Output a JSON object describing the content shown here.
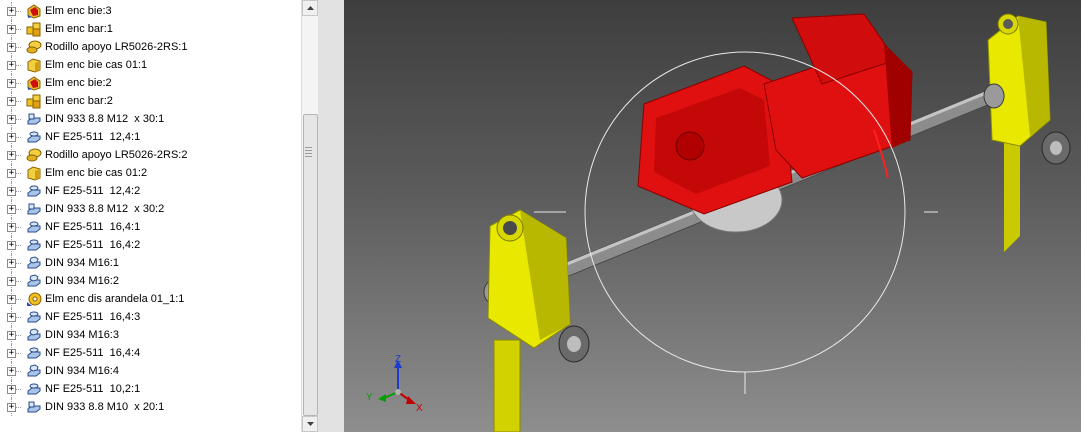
{
  "browser": {
    "items": [
      {
        "label": "Elm enc bie:3",
        "icon": "part-red-icon"
      },
      {
        "label": "Elm enc bar:1",
        "icon": "assembly-icon"
      },
      {
        "label": "Rodillo apoyo LR5026-2RS:1",
        "icon": "roller-icon"
      },
      {
        "label": "Elm enc bie cas 01:1",
        "icon": "part-yellow-icon"
      },
      {
        "label": "Elm enc bie:2",
        "icon": "part-red-icon"
      },
      {
        "label": "Elm enc bar:2",
        "icon": "assembly-icon"
      },
      {
        "label": "DIN 933 8.8 M12  x 30:1",
        "icon": "bolt-icon"
      },
      {
        "label": "NF E25-511  12,4:1",
        "icon": "washer-icon"
      },
      {
        "label": "Rodillo apoyo LR5026-2RS:2",
        "icon": "roller-icon"
      },
      {
        "label": "Elm enc bie cas 01:2",
        "icon": "part-yellow-icon"
      },
      {
        "label": "NF E25-511  12,4:2",
        "icon": "washer-icon"
      },
      {
        "label": "DIN 933 8.8 M12  x 30:2",
        "icon": "bolt-icon"
      },
      {
        "label": "NF E25-511  16,4:1",
        "icon": "washer-icon"
      },
      {
        "label": "NF E25-511  16,4:2",
        "icon": "washer-icon"
      },
      {
        "label": "DIN 934 M16:1",
        "icon": "nut-icon"
      },
      {
        "label": "DIN 934 M16:2",
        "icon": "nut-icon"
      },
      {
        "label": "Elm enc dis arandela 01_1:1",
        "icon": "part-assembly-icon"
      },
      {
        "label": "NF E25-511  16,4:3",
        "icon": "washer-icon"
      },
      {
        "label": "DIN 934 M16:3",
        "icon": "nut-icon"
      },
      {
        "label": "NF E25-511  16,4:4",
        "icon": "washer-icon"
      },
      {
        "label": "DIN 934 M16:4",
        "icon": "nut-icon"
      },
      {
        "label": "NF E25-511  10,2:1",
        "icon": "washer-icon"
      },
      {
        "label": "DIN 933 8.8 M10  x 20:1",
        "icon": "bolt-icon"
      }
    ]
  },
  "viewport": {
    "triad": {
      "x_label": "X",
      "y_label": "Y",
      "z_label": "Z"
    },
    "colors": {
      "motor": "#e01010",
      "motor_dark": "#9a0000",
      "support": "#e8e800",
      "support_dark": "#9c9c00",
      "shaft": "#8c8c8c",
      "triad_x": "#c00000",
      "triad_y": "#00a000",
      "triad_z": "#1a3cc8"
    }
  }
}
